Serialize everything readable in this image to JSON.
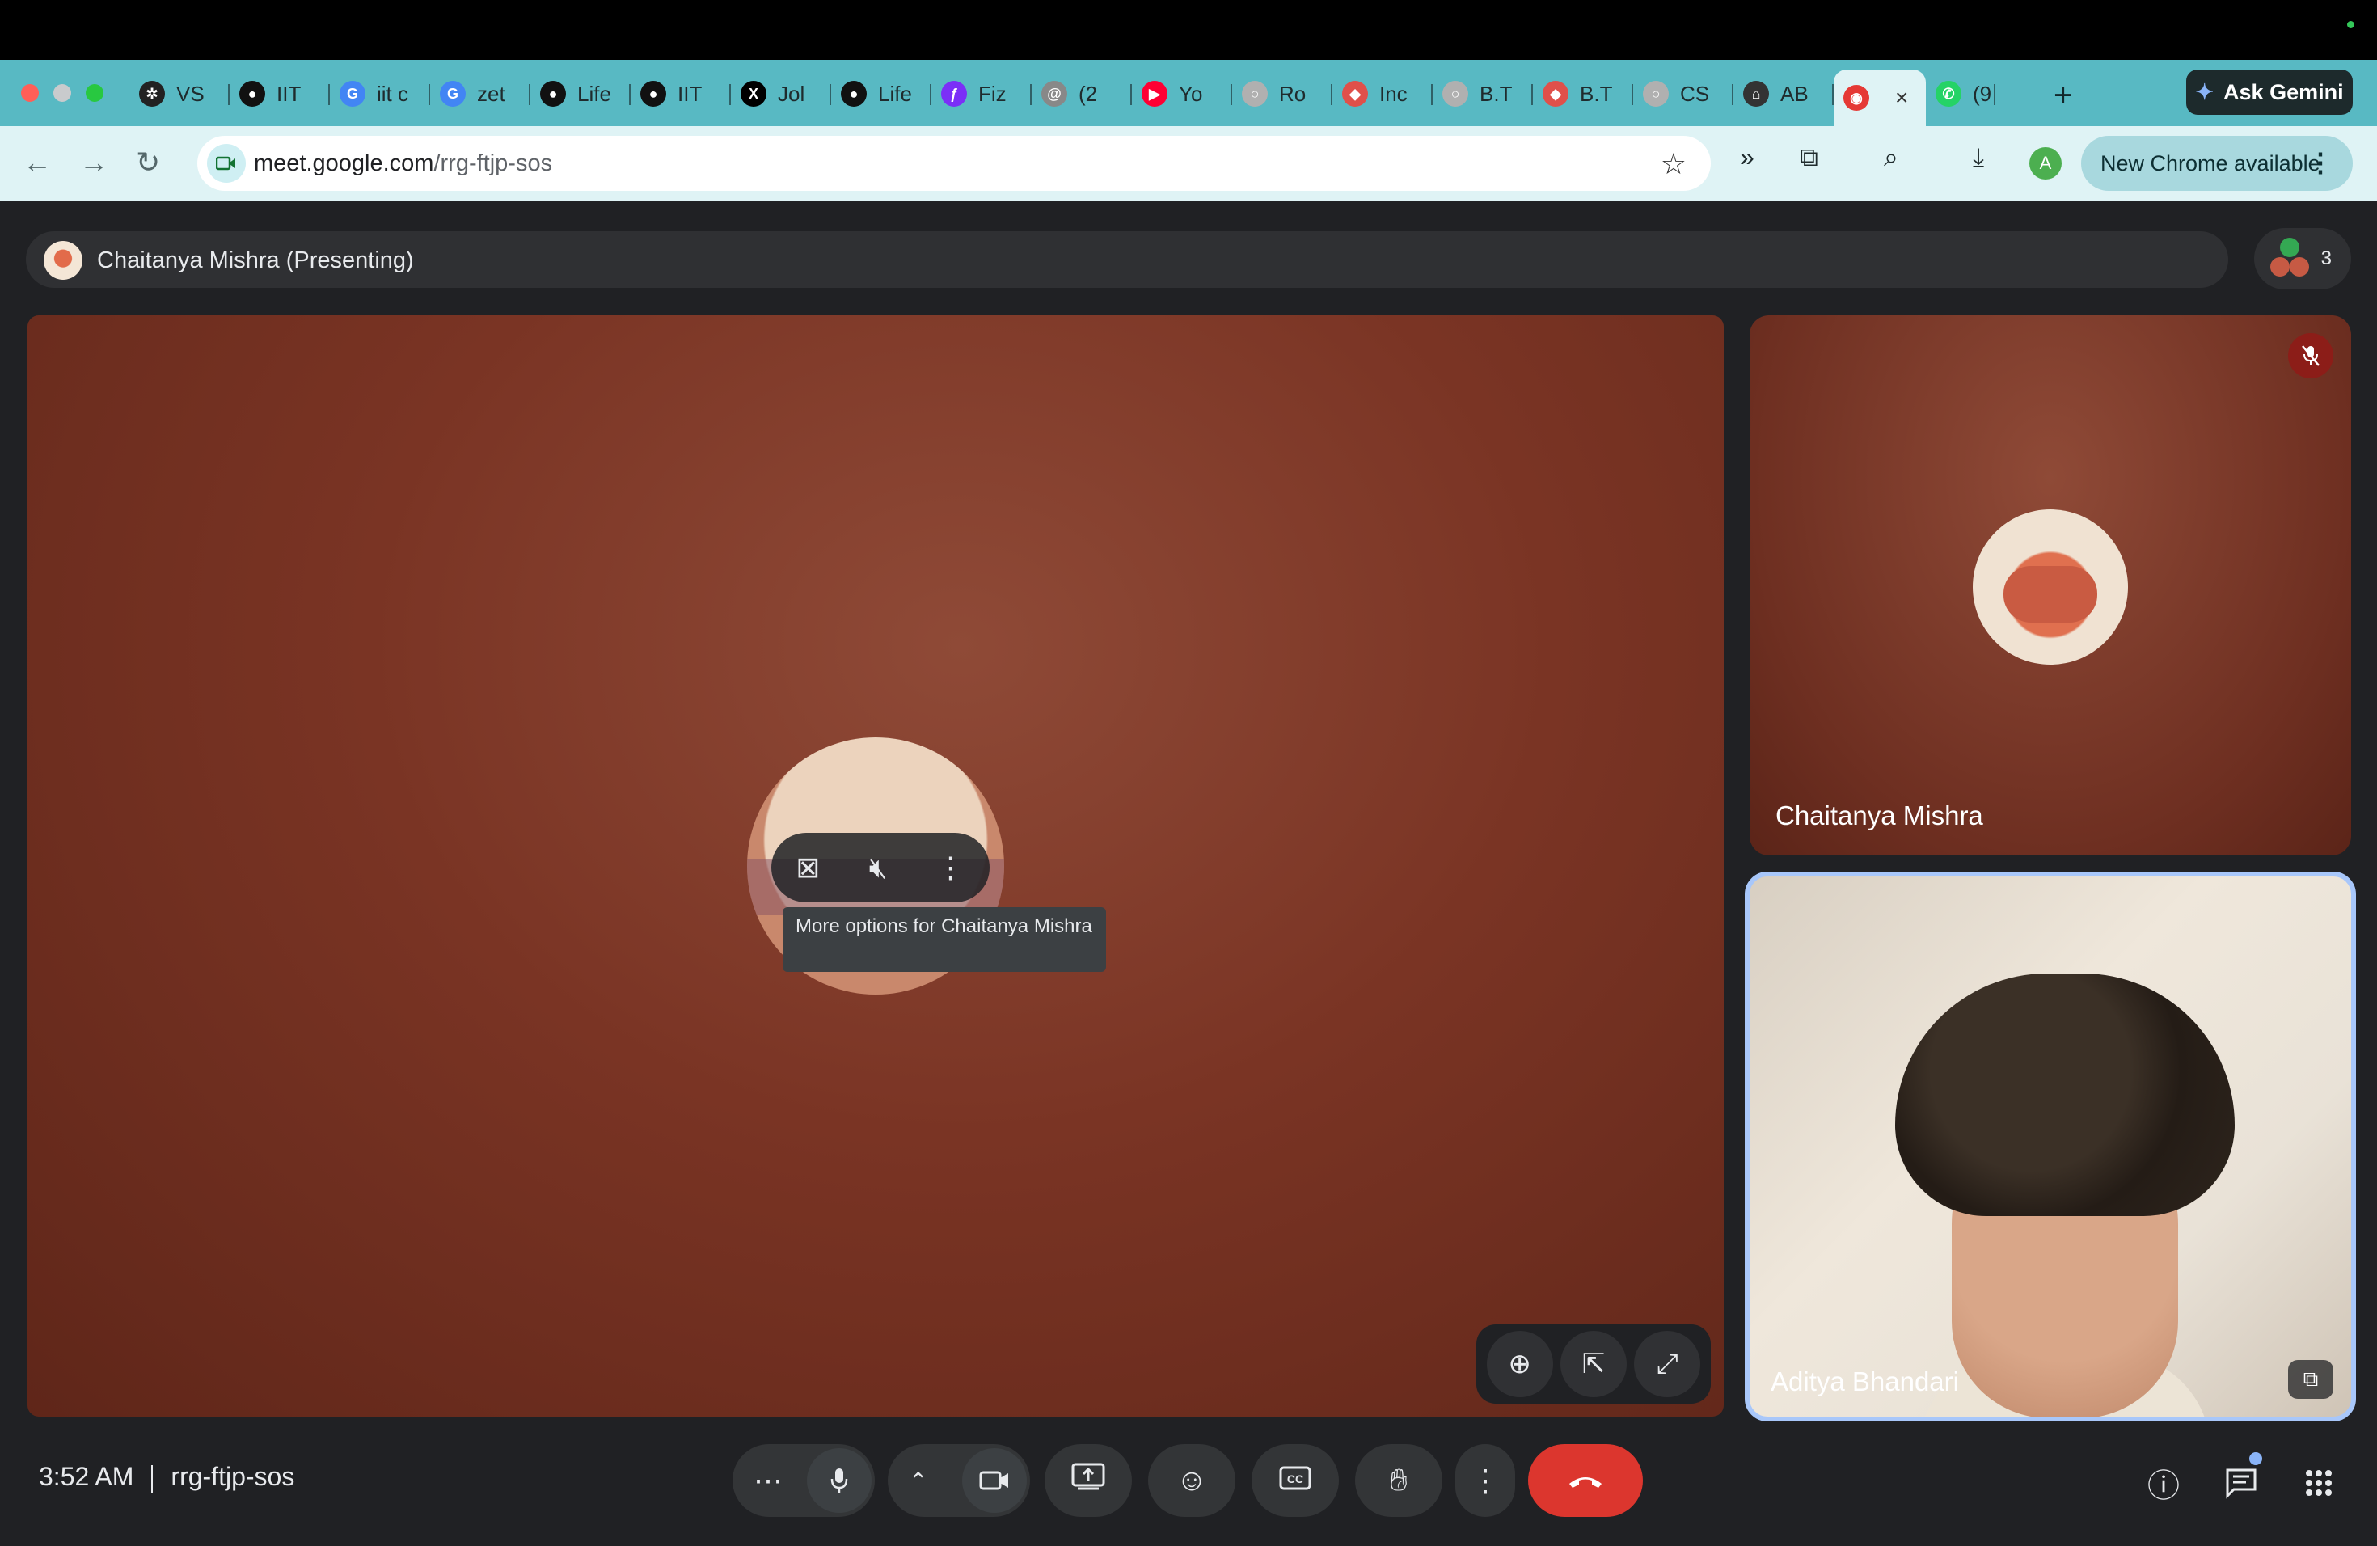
{
  "browser": {
    "tabs": [
      {
        "label": "VS",
        "icon": "openai-icon",
        "color": "#222222"
      },
      {
        "label": "IIT",
        "icon": "panda-icon",
        "color": "#111111"
      },
      {
        "label": "iit c",
        "icon": "google-icon",
        "color": "#4285f4"
      },
      {
        "label": "zet",
        "icon": "google-icon",
        "color": "#4285f4"
      },
      {
        "label": "Life",
        "icon": "panda-icon",
        "color": "#111111"
      },
      {
        "label": "IIT",
        "icon": "panda-icon",
        "color": "#111111"
      },
      {
        "label": "Jol",
        "icon": "x-icon",
        "color": "#000000"
      },
      {
        "label": "Life",
        "icon": "panda-icon",
        "color": "#111111"
      },
      {
        "label": "Fiz",
        "icon": "fizz-icon",
        "color": "#7b2ff7"
      },
      {
        "label": "(2",
        "icon": "thread-icon",
        "color": "#888888"
      },
      {
        "label": "Yo",
        "icon": "youtube-icon",
        "color": "#ff0033"
      },
      {
        "label": "Ro",
        "icon": "circle-icon",
        "color": "#b0b0b0"
      },
      {
        "label": "Inc",
        "icon": "gem-icon",
        "color": "#e0504a"
      },
      {
        "label": "B.T",
        "icon": "circle-icon",
        "color": "#b0b0b0"
      },
      {
        "label": "B.T",
        "icon": "gem-icon",
        "color": "#e0504a"
      },
      {
        "label": "CS",
        "icon": "circle-icon",
        "color": "#b0b0b0"
      },
      {
        "label": "AB",
        "icon": "cse-icon",
        "color": "#333333"
      }
    ],
    "active_tab": {
      "icon": "recording-icon",
      "close": "×"
    },
    "last_tab": {
      "label": "(9",
      "icon": "whatsapp-icon"
    },
    "new_tab": "+",
    "gemini_label": "Ask Gemini",
    "url_host": "meet.google.com",
    "url_path": "/rrg-ftjp-sos",
    "profile_initial": "A",
    "update_label": "New Chrome available"
  },
  "meet": {
    "presenting_label": "Chaitanya Mishra (Presenting)",
    "participant_count": "3",
    "tooltip": "More options for Chaitanya Mishra",
    "tiles": [
      {
        "name": "Chaitanya Mishra"
      },
      {
        "name": "Aditya Bhandari"
      }
    ],
    "time": "3:52 AM",
    "meeting_code": "rrg-ftjp-sos"
  },
  "colors": {
    "tab_strip": "#58b9c3",
    "toolbar": "#dff3f5",
    "end_call": "#dc362e",
    "meet_bg": "#202124",
    "active_tile_border": "#a8c7fa"
  }
}
